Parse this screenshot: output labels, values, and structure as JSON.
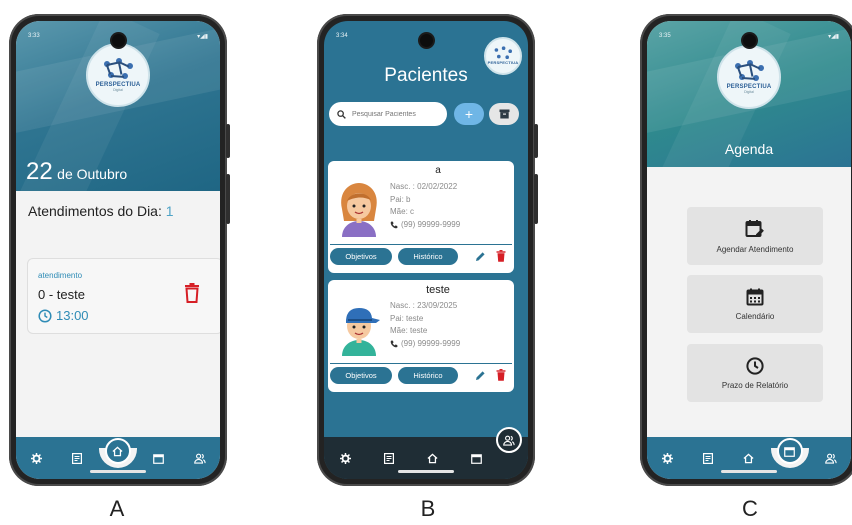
{
  "captions": [
    "A",
    "B",
    "C"
  ],
  "phoneA": {
    "status_time": "3:33",
    "logo_brand": "PERSPECTIUA",
    "logo_sub": "Digital",
    "day": "22",
    "month": "de Outubro",
    "title": "Atendimentos do Dia:",
    "count": "1",
    "card": {
      "label": "atendimento",
      "name": "0 - teste",
      "time": "13:00"
    },
    "nav_icons": [
      "gear-icon",
      "list-icon",
      "home-icon",
      "calendar-icon",
      "users-icon"
    ]
  },
  "phoneB": {
    "status_time": "3:34",
    "logo_brand": "PERSPECTIUA",
    "title": "Pacientes",
    "search_placeholder": "Pesquisar Pacientes",
    "add_label": "+",
    "patients": [
      {
        "name": "a",
        "nasc": "Nasc. : 02/02/2022",
        "pai": "Pai: b",
        "mae": "Mãe: c",
        "phone": "(99) 99999-9999",
        "btn_objetivos": "Objetivos",
        "btn_historico": "Histórico"
      },
      {
        "name": "teste",
        "nasc": "Nasc. : 23/09/2025",
        "pai": "Pai: teste",
        "mae": "Mãe: teste",
        "phone": "(99) 99999-9999",
        "btn_objetivos": "Objetivos",
        "btn_historico": "Histórico"
      }
    ]
  },
  "phoneC": {
    "status_time": "3:35",
    "logo_brand": "PERSPECTIUA",
    "logo_sub": "Digital",
    "title": "Agenda",
    "buttons": [
      {
        "label": "Agendar Atendimento",
        "icon": "calendar-edit-icon"
      },
      {
        "label": "Calendário",
        "icon": "calendar-grid-icon"
      },
      {
        "label": "Prazo de Relatório",
        "icon": "clock-icon"
      }
    ]
  },
  "colors": {
    "primary": "#2b7393",
    "accent": "#2f8cb6",
    "delete": "#d61f26",
    "add": "#6fb6e6"
  }
}
